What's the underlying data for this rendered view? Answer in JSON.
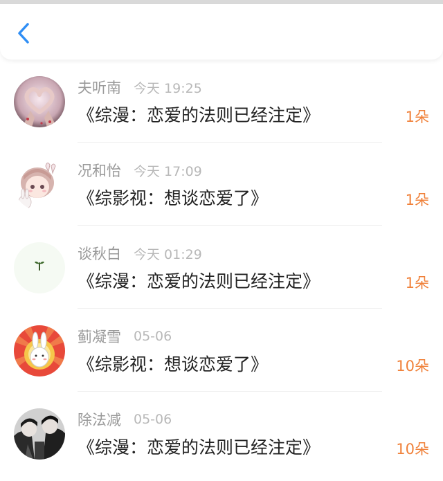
{
  "header": {
    "back_icon": "chevron-left-icon",
    "accent_color": "#2f8ef5"
  },
  "items": [
    {
      "name": "夫听南",
      "time": "今天 19:25",
      "title": "《综漫：恋爱的法则已经注定》",
      "amount": "1朵",
      "avatar": "hand-heart-avatar"
    },
    {
      "name": "况和怡",
      "time": "今天 17:09",
      "title": "《综影视：想谈恋爱了》",
      "amount": "1朵",
      "avatar": "anime-girl-bunny-avatar"
    },
    {
      "name": "谈秋白",
      "time": "今天 01:29",
      "title": "《综漫：恋爱的法则已经注定》",
      "amount": "1朵",
      "avatar": "sprout-avatar"
    },
    {
      "name": "蓟凝雪",
      "time": "05-06",
      "title": "《综影视：想谈恋爱了》",
      "amount": "10朵",
      "avatar": "rabbit-sunburst-avatar"
    },
    {
      "name": "除法减",
      "time": "05-06",
      "title": "《综漫：恋爱的法则已经注定》",
      "amount": "10朵",
      "avatar": "dark-anime-avatar"
    }
  ],
  "colors": {
    "amount": "#f0813a",
    "name": "#9a9a9a",
    "time": "#b8b8b8",
    "title": "#222222"
  }
}
